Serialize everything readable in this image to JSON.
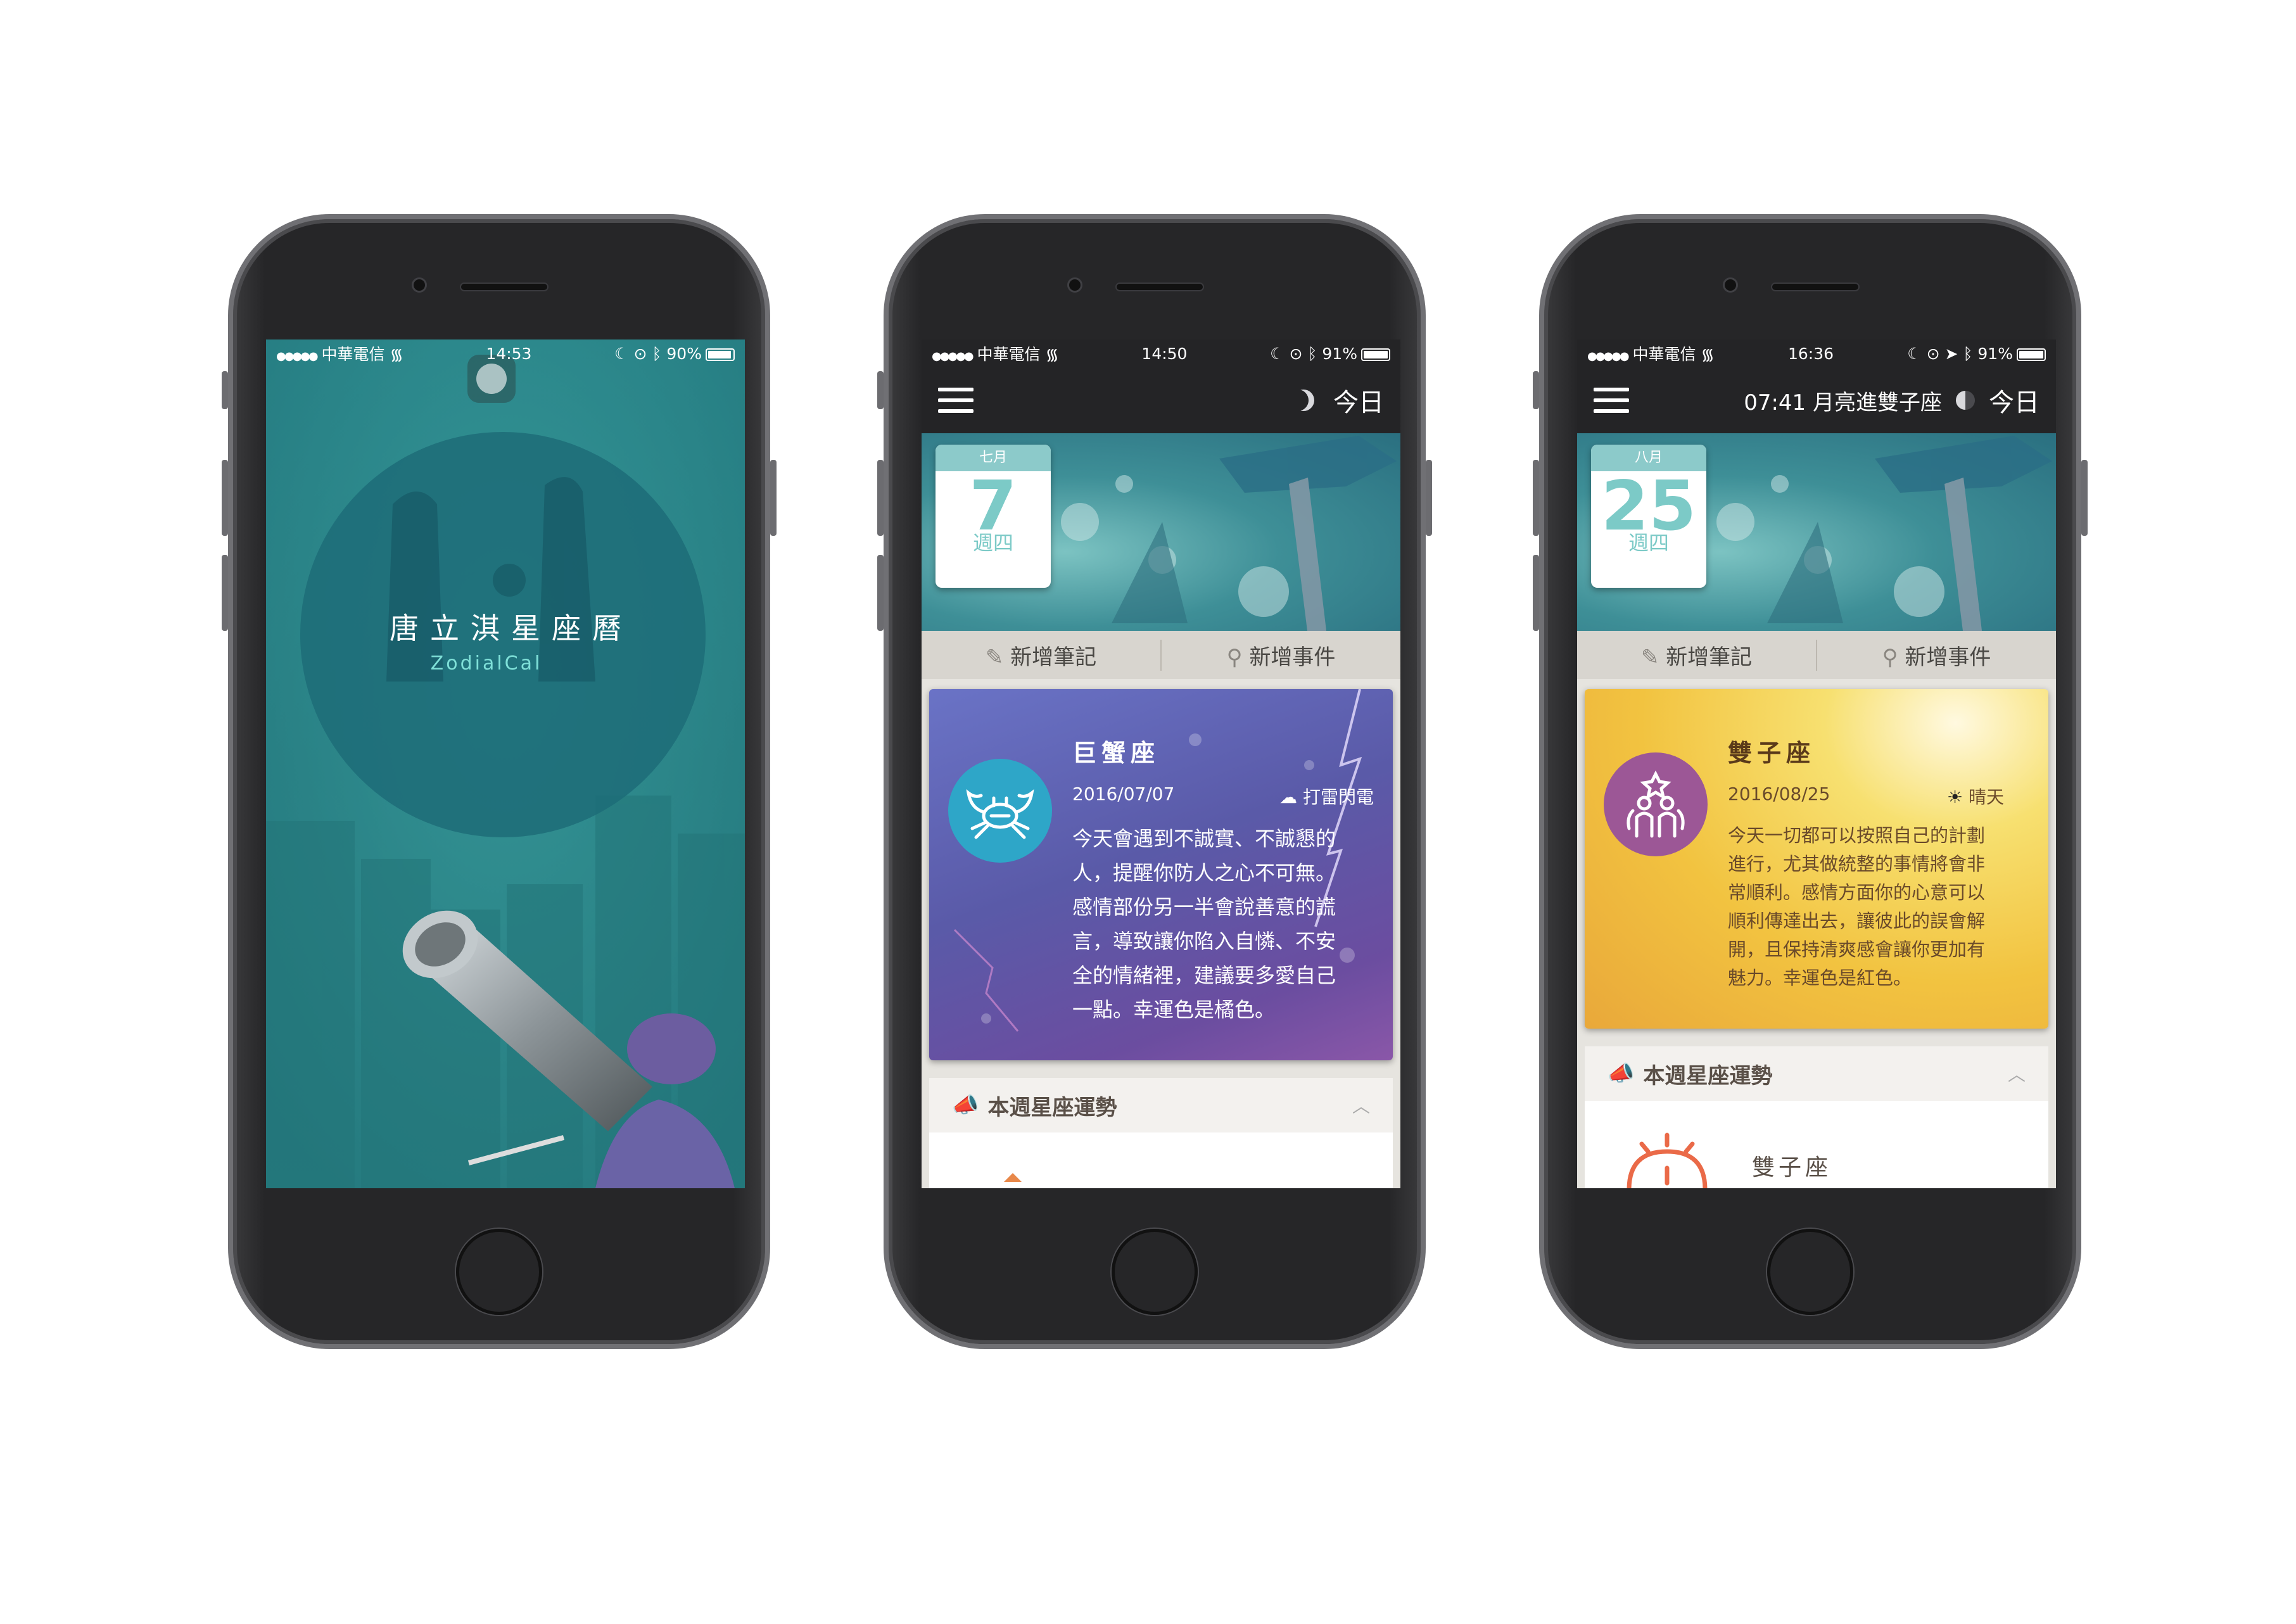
{
  "phone1": {
    "status": {
      "carrier": "中華電信",
      "time": "14:53",
      "battery": "90%"
    },
    "app_title": "唐立淇星座曆",
    "app_subtitle": "ZodialCal"
  },
  "phone2": {
    "status": {
      "carrier": "中華電信",
      "time": "14:50",
      "battery": "91%"
    },
    "today_button": "今日",
    "calendar": {
      "month": "七月",
      "day": "7",
      "weekday": "週四"
    },
    "actions": {
      "add_note": "新增筆記",
      "add_event": "新增事件"
    },
    "card": {
      "sign": "巨蟹座",
      "date": "2016/07/07",
      "weather": "打雷閃電",
      "text_lines": [
        "今天會遇到不誠實、不誠懇的",
        "人，提醒你防人之心不可無。",
        "感情部份另一半會說善意的謊",
        "言，導致讓你陷入自憐、不安",
        "全的情緒裡，建議要多愛自己",
        "一點。幸運色是橘色。"
      ]
    },
    "weekly_title": "本週星座運勢"
  },
  "phone3": {
    "status": {
      "carrier": "中華電信",
      "time": "16:36",
      "battery": "91%"
    },
    "moon_event": "07:41 月亮進雙子座",
    "today_button": "今日",
    "calendar": {
      "month": "八月",
      "day": "25",
      "weekday": "週四"
    },
    "actions": {
      "add_note": "新增筆記",
      "add_event": "新增事件"
    },
    "card": {
      "sign": "雙子座",
      "date": "2016/08/25",
      "weather": "晴天",
      "text_lines": [
        "今天一切都可以按照自己的計劃",
        "進行，尤其做統整的事情將會非",
        "常順利。感情方面你的心意可以",
        "順利傳達出去，讓彼此的誤會解",
        "開，且保持清爽感會讓你更加有",
        "魅力。幸運色是紅色。"
      ]
    },
    "weekly_title": "本週星座運勢",
    "weekly_sign": "雙子座"
  },
  "colors": {
    "teal": "#2d8f93",
    "calendar_accent": "#7ccac7",
    "cancer_badge": "#2ea6c8",
    "gemini_badge": "#9c5796",
    "topbar": "#242426"
  }
}
